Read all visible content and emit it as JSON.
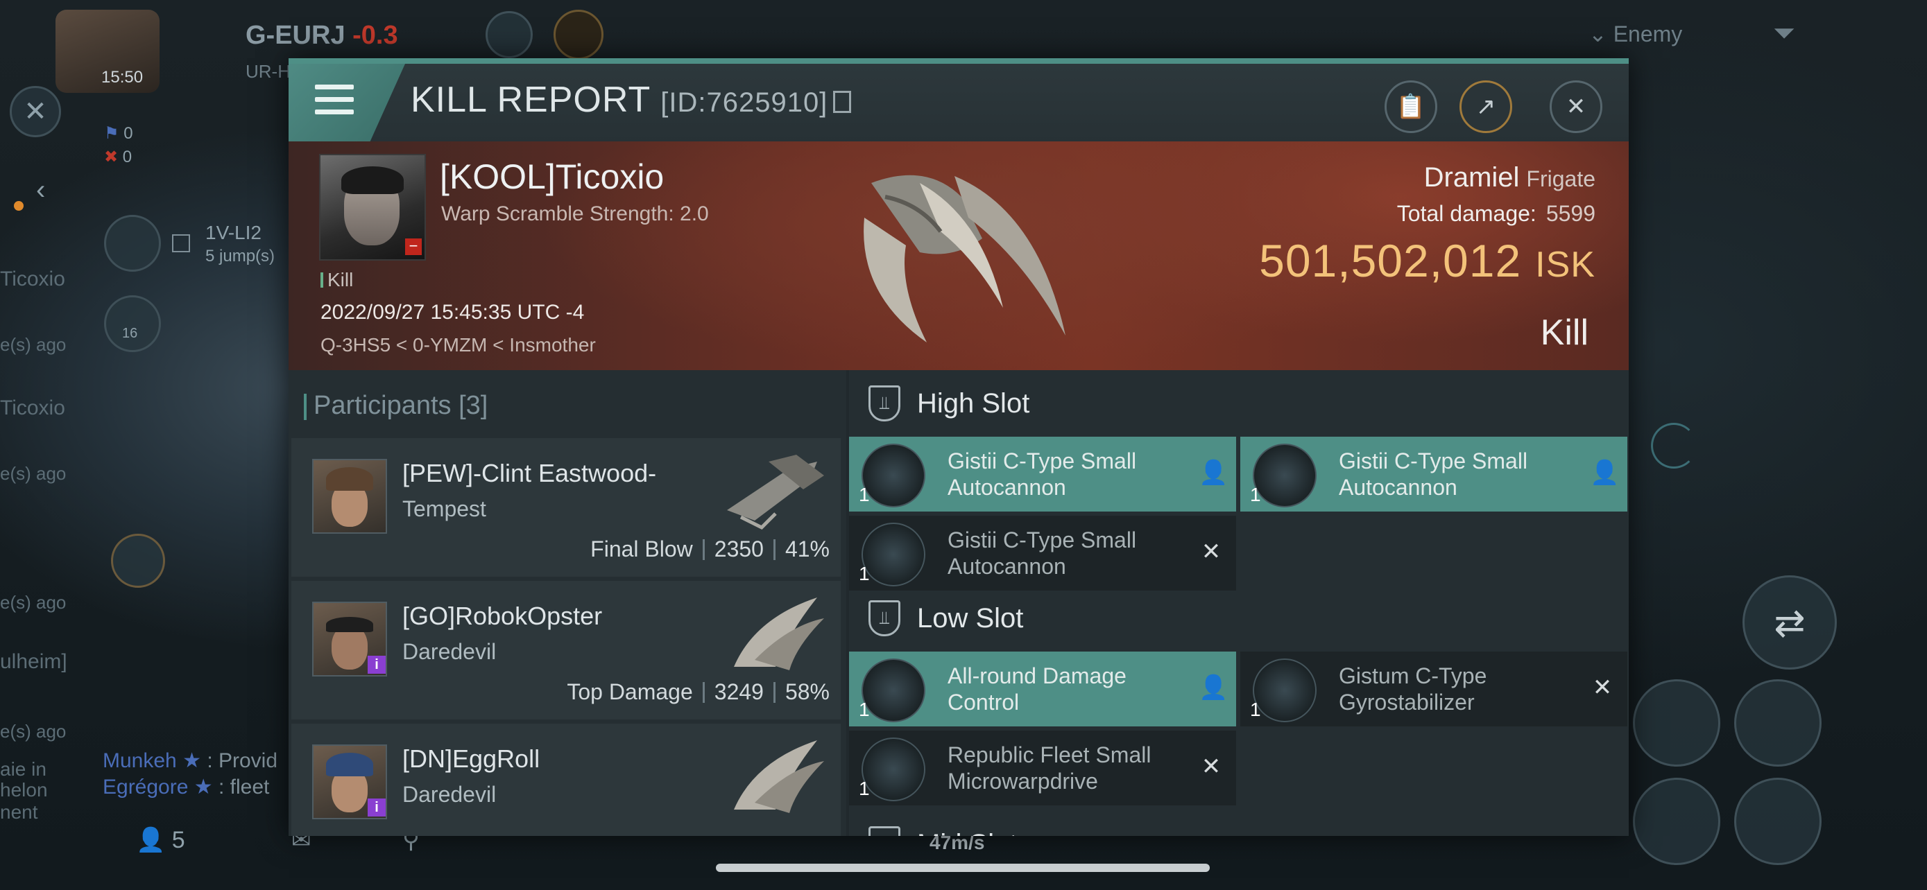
{
  "hud": {
    "system_name": "G-EURJ",
    "system_security": "-0.3",
    "system_sub": "UR-H",
    "clock": "15:50",
    "enemy_filter": "Enemy",
    "left_items": [
      "Ticoxio",
      "e(s) ago",
      "Ticoxio",
      "e(s) ago",
      "e(s) ago",
      "ulheim]",
      "e(s) ago",
      "aie in",
      "helon",
      "nent"
    ],
    "route_name": "1V-LI2",
    "route_jumps": "5 jump(s)",
    "stack_count": "16",
    "flag_count_1": "0",
    "flag_count_2": "0",
    "chat_line_1_name": "Munkeh",
    "chat_line_1_text": ": Provid",
    "chat_line_2_name": "Egrégore",
    "chat_line_2_text": ": fleet",
    "people_count": "5",
    "speed": "47m/s"
  },
  "dialog": {
    "title": "KILL REPORT",
    "report_id": "[ID:7625910]",
    "victim": {
      "name": "[KOOL]Ticoxio",
      "warp_scramble": "Warp Scramble Strength: 2.0",
      "tag": "Kill",
      "datetime": "2022/09/27 15:45:35 UTC -4",
      "location": "Q-3HS5 < 0-YMZM < Insmother",
      "ship_name": "Dramiel",
      "ship_class": "Frigate",
      "total_damage_label": "Total damage:",
      "total_damage": "5599",
      "isk_value": "501,502,012",
      "isk_unit": "ISK",
      "result": "Kill"
    },
    "participants": {
      "label": "Participants",
      "count": "[3]",
      "rows": [
        {
          "name": "[PEW]-Clint Eastwood-",
          "ship": "Tempest",
          "role": "Final Blow",
          "damage": "2350",
          "percent": "41%"
        },
        {
          "name": "[GO]RobokOpster",
          "ship": "Daredevil",
          "role": "Top Damage",
          "damage": "3249",
          "percent": "58%"
        },
        {
          "name": "[DN]EggRoll",
          "ship": "Daredevil",
          "role": "",
          "damage": "",
          "percent": ""
        }
      ]
    },
    "fittings": {
      "high_slot_title": "High Slot",
      "low_slot_title": "Low Slot",
      "mid_slot_title": "Mid Slot",
      "high": [
        {
          "name": "Gistii C-Type Small Autocannon",
          "qty": "1",
          "state": "dropped"
        },
        {
          "name": "Gistii C-Type Small Autocannon",
          "qty": "1",
          "state": "dropped"
        },
        {
          "name": "Gistii C-Type Small Autocannon",
          "qty": "1",
          "state": "destroyed"
        }
      ],
      "low": [
        {
          "name": "All-round Damage Control",
          "qty": "1",
          "state": "dropped"
        },
        {
          "name": "Gistum C-Type Gyrostabilizer",
          "qty": "1",
          "state": "destroyed"
        },
        {
          "name": "Republic Fleet Small Microwarpdrive",
          "qty": "1",
          "state": "destroyed"
        }
      ]
    }
  },
  "colors": {
    "accent": "#4e8f86",
    "isk": "#f3c27a",
    "security_negative": "#c0392b"
  }
}
